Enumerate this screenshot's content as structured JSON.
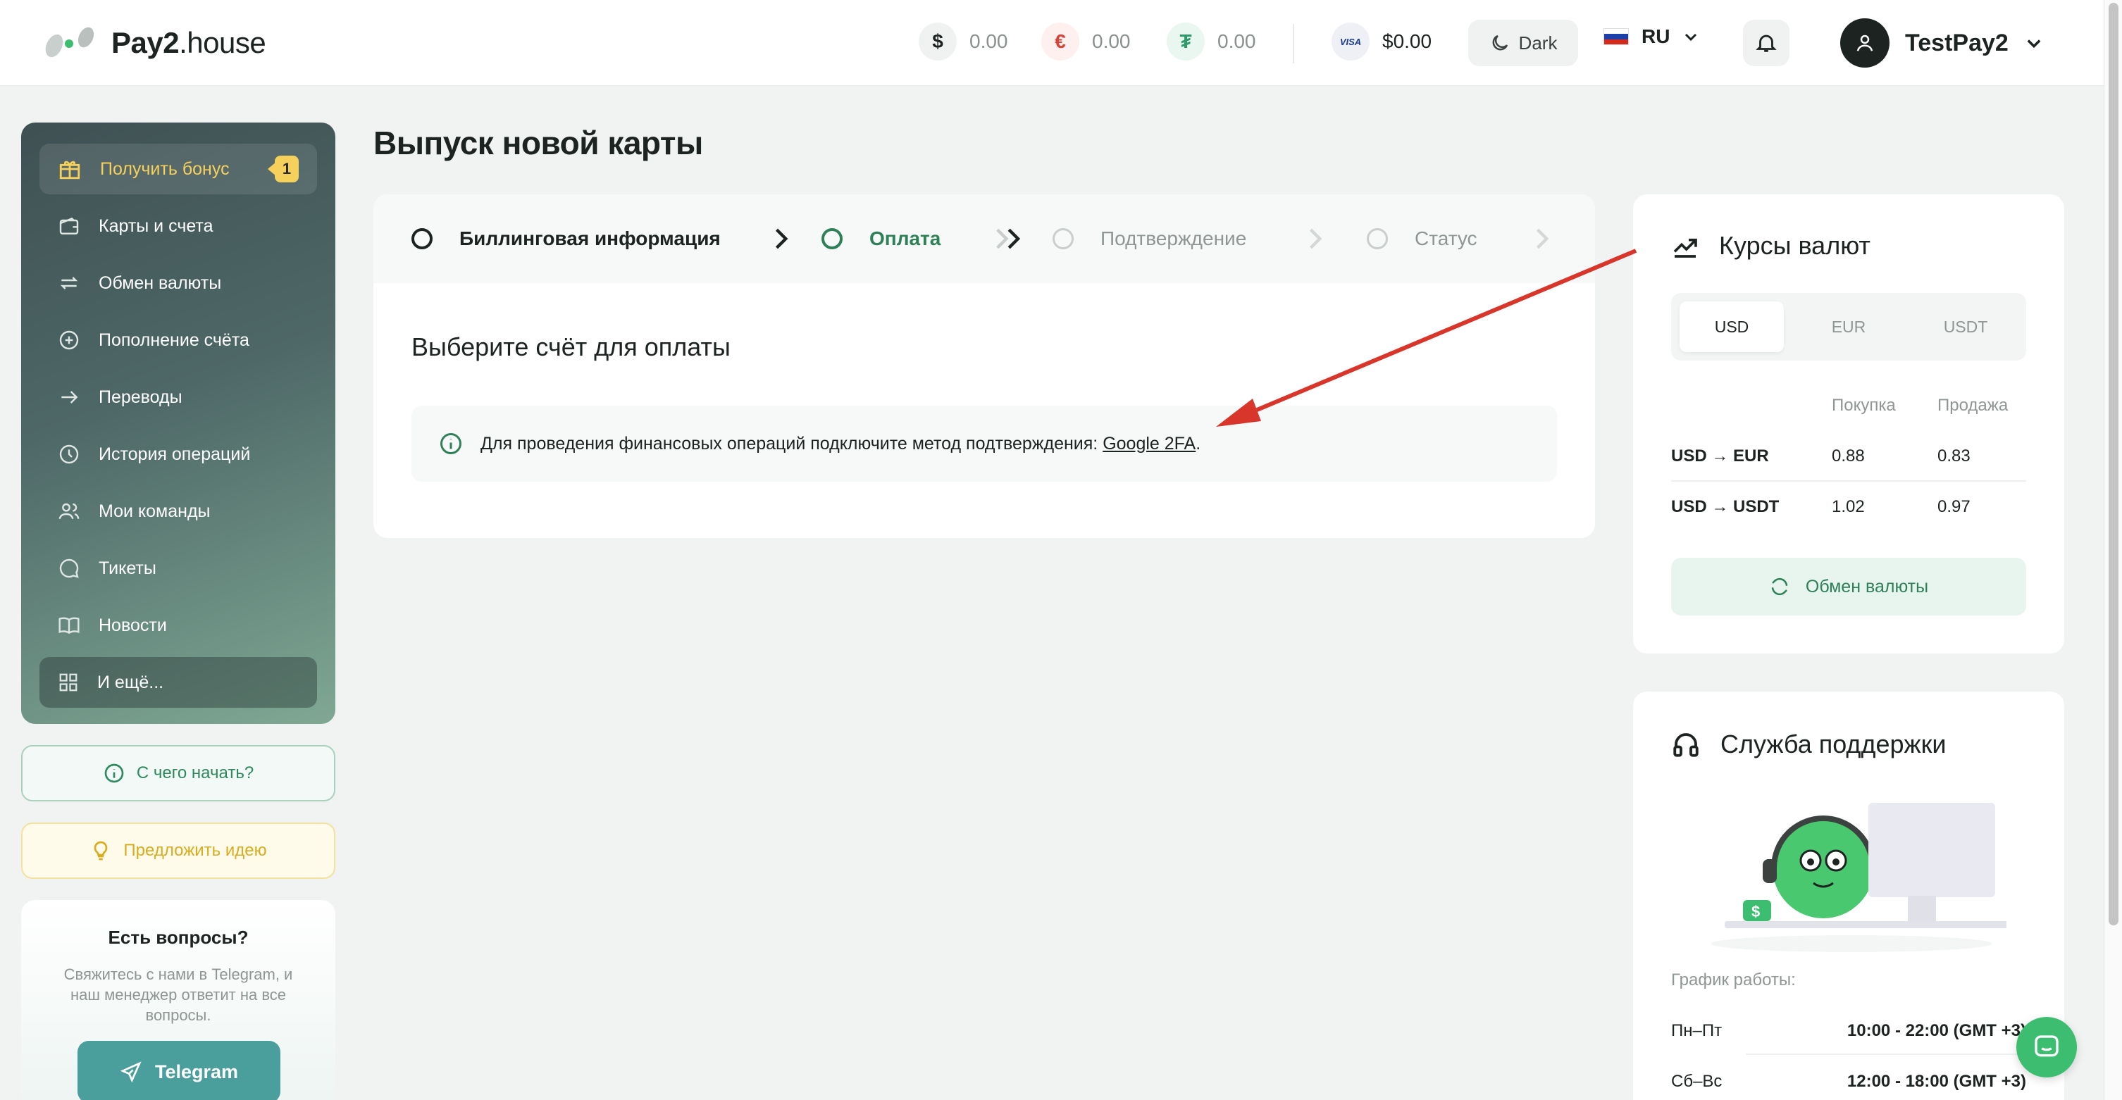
{
  "header": {
    "logo_bold": "Pay2",
    "logo_light": ".house",
    "balances": [
      {
        "symbol": "$",
        "value": "0.00",
        "icon": "dollar-icon",
        "color": "#1d2321",
        "bg": "#f0f2f1"
      },
      {
        "symbol": "€",
        "value": "0.00",
        "icon": "euro-icon",
        "color": "#d6453a",
        "bg": "#fdf0ef"
      },
      {
        "symbol": "₮",
        "value": "0.00",
        "icon": "tether-icon",
        "color": "#2e9a6c",
        "bg": "#eaf6f0"
      }
    ],
    "visa_label": "VISA",
    "visa_balance": "$0.00",
    "theme_label": "Dark",
    "language": "RU",
    "username": "TestPay2"
  },
  "sidebar": {
    "items": [
      {
        "label": "Получить бонус",
        "icon": "gift-icon",
        "badge": "1"
      },
      {
        "label": "Карты и счета",
        "icon": "wallet-icon"
      },
      {
        "label": "Обмен валюты",
        "icon": "exchange-icon"
      },
      {
        "label": "Пополнение счёта",
        "icon": "plus-circle-icon"
      },
      {
        "label": "Переводы",
        "icon": "arrow-right-icon"
      },
      {
        "label": "История операций",
        "icon": "clock-icon"
      },
      {
        "label": "Мои команды",
        "icon": "users-icon"
      },
      {
        "label": "Тикеты",
        "icon": "chat-bubble-icon"
      },
      {
        "label": "Новости",
        "icon": "book-icon"
      },
      {
        "label": "И ещё...",
        "icon": "grid-icon"
      }
    ],
    "start_button": "С чего начать?",
    "idea_button": "Предложить идею",
    "help": {
      "title": "Есть вопросы?",
      "text": "Свяжитесь с нами в Telegram, и наш менеджер ответит на все вопросы.",
      "telegram_button": "Telegram"
    }
  },
  "main": {
    "title": "Выпуск новой карты",
    "steps": [
      {
        "label": "Биллинговая информация",
        "state": "done"
      },
      {
        "label": "Оплата",
        "state": "active"
      },
      {
        "label": "Подтверждение",
        "state": "inactive"
      },
      {
        "label": "Статус",
        "state": "inactive"
      }
    ],
    "section_title": "Выберите счёт для оплаты",
    "notice_text": "Для проведения финансовых операций подключите метод подтверждения: ",
    "notice_link": "Google 2FA",
    "notice_end": "."
  },
  "rates": {
    "title": "Курсы валют",
    "tabs": [
      "USD",
      "EUR",
      "USDT"
    ],
    "selected_tab": "USD",
    "col_buy": "Покупка",
    "col_sell": "Продажа",
    "rows": [
      {
        "pair": "USD → EUR",
        "buy": "0.88",
        "sell": "0.83"
      },
      {
        "pair": "USD → USDT",
        "buy": "1.02",
        "sell": "0.97"
      }
    ],
    "exchange_button": "Обмен валюты"
  },
  "support": {
    "title": "Служба поддержки",
    "schedule_label": "График работы:",
    "schedule": [
      {
        "days": "Пн–Пт",
        "hours": "10:00 - 22:00 (GMT +3)"
      },
      {
        "days": "Сб–Вс",
        "hours": "12:00 - 18:00 (GMT +3)"
      }
    ]
  },
  "colors": {
    "accent": "#2e8059",
    "bonus": "#f5d15c",
    "annotation_arrow": "#d9362b"
  }
}
